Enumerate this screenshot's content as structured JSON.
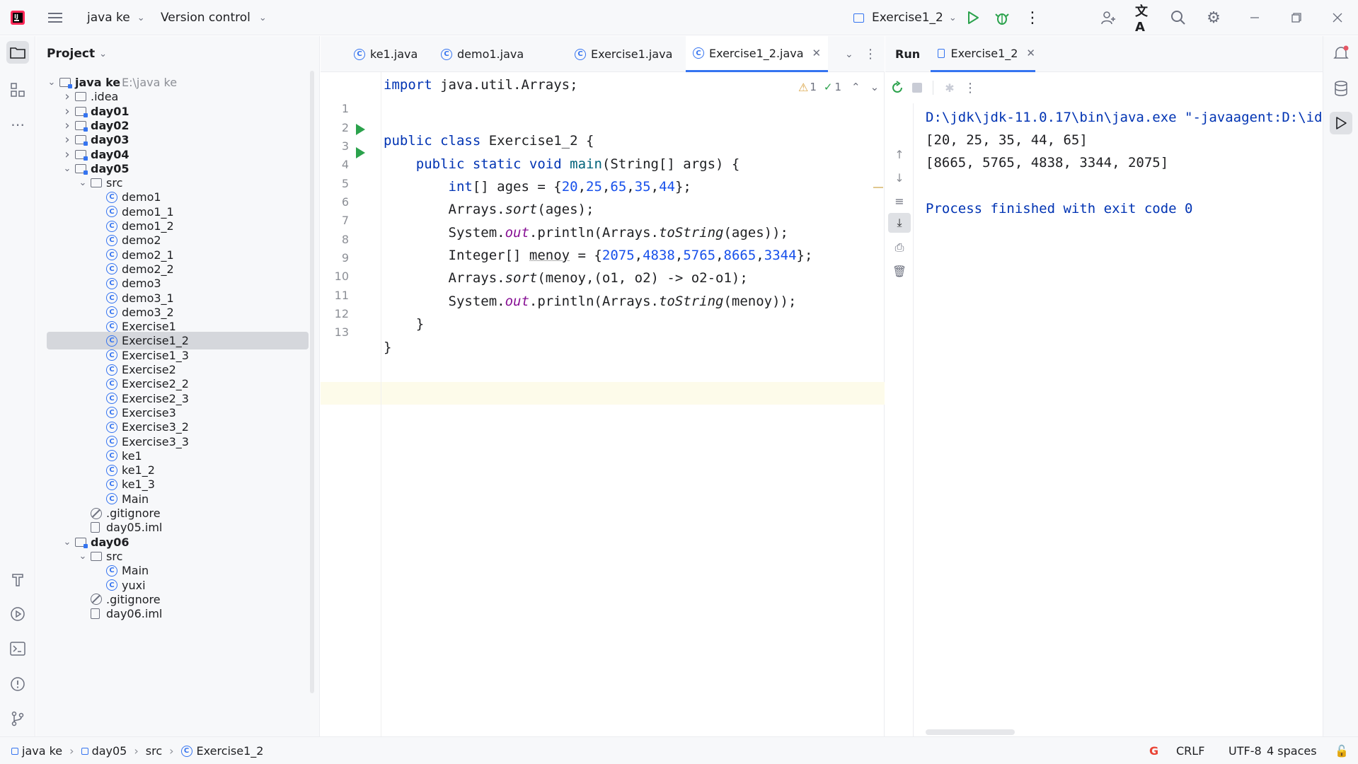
{
  "titlebar": {
    "project_name": "java ke",
    "vcs_label": "Version control",
    "run_config": "Exercise1_2"
  },
  "project_panel": {
    "title": "Project",
    "root_label": "java ke",
    "root_path": "E:\\java ke",
    "tree": [
      {
        "label": "java ke",
        "indent": 0,
        "type": "module",
        "expanded": true,
        "bold": true
      },
      {
        "label": ".idea",
        "indent": 1,
        "type": "folder",
        "expanded": false,
        "bold": false
      },
      {
        "label": "day01",
        "indent": 1,
        "type": "module",
        "expanded": false,
        "bold": true
      },
      {
        "label": "day02",
        "indent": 1,
        "type": "module",
        "expanded": false,
        "bold": true
      },
      {
        "label": "day03",
        "indent": 1,
        "type": "module",
        "expanded": false,
        "bold": true
      },
      {
        "label": "day04",
        "indent": 1,
        "type": "module",
        "expanded": false,
        "bold": true
      },
      {
        "label": "day05",
        "indent": 1,
        "type": "module",
        "expanded": true,
        "bold": true
      },
      {
        "label": "src",
        "indent": 2,
        "type": "folder",
        "expanded": true,
        "bold": false
      },
      {
        "label": "demo1",
        "indent": 3,
        "type": "class"
      },
      {
        "label": "demo1_1",
        "indent": 3,
        "type": "class"
      },
      {
        "label": "demo1_2",
        "indent": 3,
        "type": "class"
      },
      {
        "label": "demo2",
        "indent": 3,
        "type": "class"
      },
      {
        "label": "demo2_1",
        "indent": 3,
        "type": "class"
      },
      {
        "label": "demo2_2",
        "indent": 3,
        "type": "class"
      },
      {
        "label": "demo3",
        "indent": 3,
        "type": "class"
      },
      {
        "label": "demo3_1",
        "indent": 3,
        "type": "class"
      },
      {
        "label": "demo3_2",
        "indent": 3,
        "type": "class"
      },
      {
        "label": "Exercise1",
        "indent": 3,
        "type": "class"
      },
      {
        "label": "Exercise1_2",
        "indent": 3,
        "type": "class",
        "selected": true
      },
      {
        "label": "Exercise1_3",
        "indent": 3,
        "type": "class"
      },
      {
        "label": "Exercise2",
        "indent": 3,
        "type": "class"
      },
      {
        "label": "Exercise2_2",
        "indent": 3,
        "type": "class"
      },
      {
        "label": "Exercise2_3",
        "indent": 3,
        "type": "class"
      },
      {
        "label": "Exercise3",
        "indent": 3,
        "type": "class"
      },
      {
        "label": "Exercise3_2",
        "indent": 3,
        "type": "class"
      },
      {
        "label": "Exercise3_3",
        "indent": 3,
        "type": "class"
      },
      {
        "label": "ke1",
        "indent": 3,
        "type": "class"
      },
      {
        "label": "ke1_2",
        "indent": 3,
        "type": "class"
      },
      {
        "label": "ke1_3",
        "indent": 3,
        "type": "class"
      },
      {
        "label": "Main",
        "indent": 3,
        "type": "class"
      },
      {
        "label": ".gitignore",
        "indent": 2,
        "type": "ignore"
      },
      {
        "label": "day05.iml",
        "indent": 2,
        "type": "file"
      },
      {
        "label": "day06",
        "indent": 1,
        "type": "module",
        "expanded": true,
        "bold": true
      },
      {
        "label": "src",
        "indent": 2,
        "type": "folder",
        "expanded": true,
        "bold": false
      },
      {
        "label": "Main",
        "indent": 3,
        "type": "class"
      },
      {
        "label": "yuxi",
        "indent": 3,
        "type": "class"
      },
      {
        "label": ".gitignore",
        "indent": 2,
        "type": "ignore"
      },
      {
        "label": "day06.iml",
        "indent": 2,
        "type": "file"
      }
    ]
  },
  "editor": {
    "tabs": [
      {
        "label": "ke1.java",
        "active": false
      },
      {
        "label": "demo1.java",
        "active": false
      },
      {
        "label": "Exercise1.java",
        "active": false
      },
      {
        "label": "Exercise1_2.java",
        "active": true
      }
    ],
    "inspections": {
      "warnings": "1",
      "ok": "1"
    },
    "line_numbers": [
      "1",
      "2",
      "3",
      "4",
      "5",
      "6",
      "7",
      "8",
      "9",
      "10",
      "11",
      "12",
      "13"
    ]
  },
  "run_panel": {
    "title": "Run",
    "tab": "Exercise1_2",
    "console": [
      "D:\\jdk\\jdk-11.0.17\\bin\\java.exe \"-javaagent:D:\\idea",
      "[20, 25, 35, 44, 65]",
      "[8665, 5765, 4838, 3344, 2075]",
      "",
      "Process finished with exit code 0"
    ]
  },
  "statusbar": {
    "breadcrumb": [
      "java ke",
      "day05",
      "src",
      "Exercise1_2"
    ],
    "line_sep": "CRLF",
    "encoding": "UTF-8",
    "indent": "4 spaces"
  },
  "colors": {
    "accent": "#3574f0",
    "run_green": "#2ba24c",
    "keyword": "#0033b3",
    "number": "#1750eb",
    "console_path": "#0033b3"
  }
}
